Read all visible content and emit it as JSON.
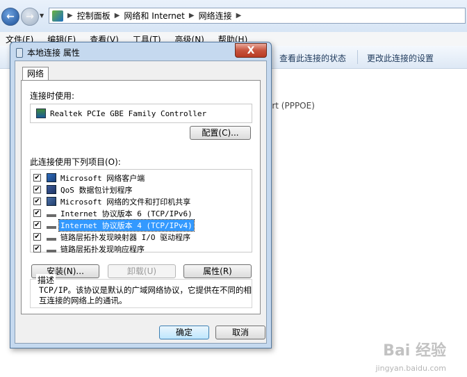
{
  "explorer": {
    "breadcrumb": [
      "控制面板",
      "网络和 Internet",
      "网络连接"
    ],
    "menu": [
      "文件(F)",
      "编辑(E)",
      "查看(V)",
      "工具(T)",
      "高级(N)",
      "帮助(H)"
    ],
    "commands": [
      "查看此连接的状态",
      "更改此连接的设置"
    ],
    "background_text": "ort (PPPOE)"
  },
  "dialog": {
    "title": "本地连接 属性",
    "close": "X",
    "tab": "网络",
    "connect_using_label": "连接时使用:",
    "adapter": "Realtek PCIe GBE Family Controller",
    "configure_button": "配置(C)...",
    "items_label": "此连接使用下列项目(O):",
    "items": [
      {
        "label": "Microsoft 网络客户端",
        "checked": true,
        "icon": "network-client-icon"
      },
      {
        "label": "QoS 数据包计划程序",
        "checked": true,
        "icon": "qos-icon"
      },
      {
        "label": "Microsoft 网络的文件和打印机共享",
        "checked": true,
        "icon": "file-share-icon"
      },
      {
        "label": "Internet 协议版本 6 (TCP/IPv6)",
        "checked": true,
        "icon": "protocol-icon"
      },
      {
        "label": "Internet 协议版本 4 (TCP/IPv4)",
        "checked": true,
        "icon": "protocol-icon",
        "selected": true
      },
      {
        "label": "链路层拓扑发现映射器 I/O 驱动程序",
        "checked": true,
        "icon": "protocol-icon"
      },
      {
        "label": "链路层拓扑发现响应程序",
        "checked": true,
        "icon": "protocol-icon"
      }
    ],
    "install_button": "安装(N)...",
    "uninstall_button": "卸载(U)",
    "properties_button": "属性(R)",
    "description_label": "描述",
    "description_text": "TCP/IP。该协议是默认的广域网络协议，它提供在不同的相互连接的网络上的通讯。",
    "ok_button": "确定",
    "cancel_button": "取消"
  },
  "watermark": {
    "main": "Bai 经验",
    "sub": "jingyan.baidu.com"
  }
}
